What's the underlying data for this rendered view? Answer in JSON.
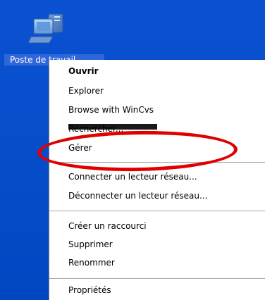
{
  "desktop_icon": {
    "label": "Poste de travail",
    "icon": "my-computer-icon"
  },
  "menu": {
    "items": [
      {
        "label": "Ouvrir",
        "bold": true
      },
      {
        "label": "Explorer"
      },
      {
        "label": "Browse with WinCvs"
      },
      {
        "label": "Rechercher..."
      },
      {
        "label": "Gérer"
      },
      {
        "label": "Connecter un lecteur réseau..."
      },
      {
        "label": "Déconnecter un lecteur réseau..."
      },
      {
        "label": "Créer un raccourci"
      },
      {
        "label": "Supprimer"
      },
      {
        "label": "Renommer"
      },
      {
        "label": "Propriétés"
      }
    ]
  },
  "colors": {
    "desktop": "#0a4fc9",
    "label_highlight": "#2f67d9",
    "annotation": "#e00000"
  }
}
